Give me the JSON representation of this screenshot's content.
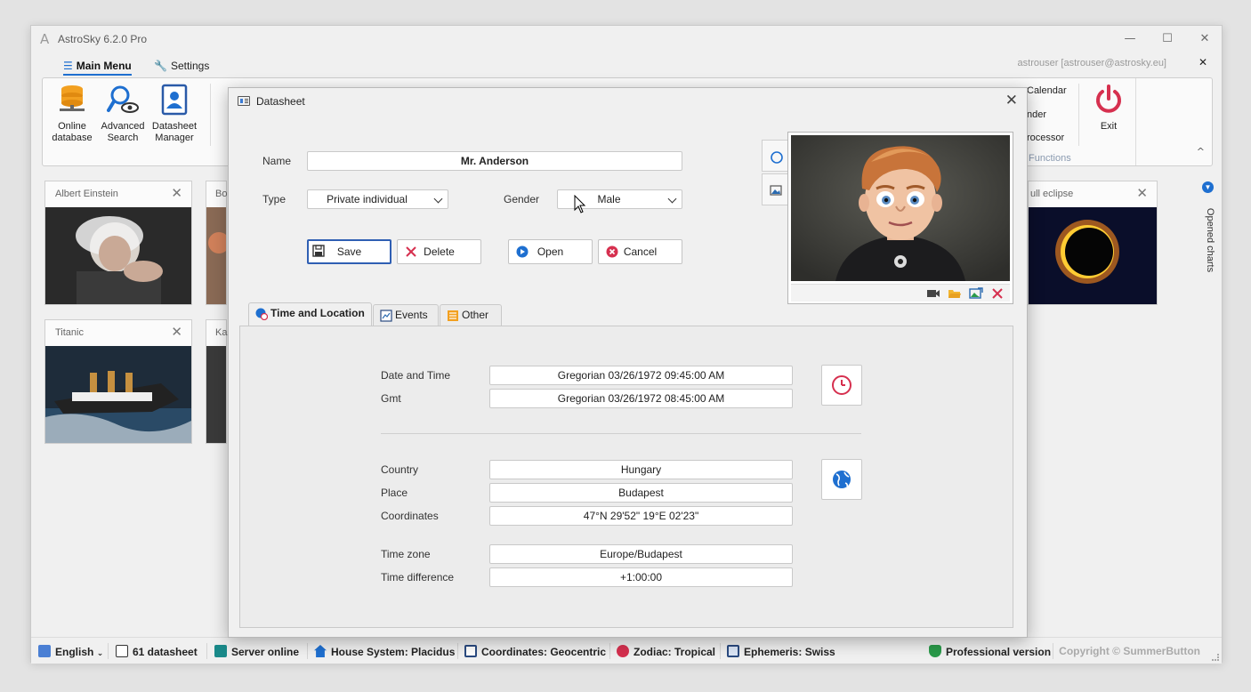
{
  "app": {
    "title": "AstroSky 6.2.0 Pro",
    "logo_letter": "A",
    "window_controls": {
      "minimize": "—",
      "maximize": "☐",
      "close": "✕"
    }
  },
  "menu": {
    "tabs": [
      {
        "label": "Main Menu",
        "icon": "hamburger-icon",
        "active": true
      },
      {
        "label": "Settings",
        "icon": "wrench-icon",
        "active": false
      }
    ],
    "user": "astrouser [astrouser@astrosky.eu]",
    "user_close": "✕"
  },
  "ribbon": {
    "buttons": [
      {
        "label_line1": "Online",
        "label_line2": "database",
        "icon": "database-icon"
      },
      {
        "label_line1": "Advanced",
        "label_line2": "Search",
        "icon": "search-eye-icon"
      },
      {
        "label_line1": "Datasheet",
        "label_line2": "Manager",
        "icon": "datasheet-icon"
      }
    ],
    "right_list": [
      "Calendar",
      "nder",
      "rocessor"
    ],
    "group_label": "Functions",
    "exit_label": "Exit",
    "collapse": "^"
  },
  "opened_charts": {
    "label": "Opened charts"
  },
  "cards": [
    {
      "title": "Albert Einstein",
      "close": "✕"
    },
    {
      "title": "Bor",
      "close": ""
    },
    {
      "title": "Titanic",
      "close": "✕"
    },
    {
      "title": "Kar",
      "close": ""
    },
    {
      "title": "ull eclipse",
      "close": "✕"
    }
  ],
  "dialog": {
    "title": "Datasheet",
    "close": "✕",
    "name_label": "Name",
    "name_value": "Mr. Anderson",
    "type_label": "Type",
    "type_value": "Private individual",
    "gender_label": "Gender",
    "gender_value": "Male",
    "buttons": {
      "save": "Save",
      "delete": "Delete",
      "open": "Open",
      "cancel": "Cancel"
    },
    "tabs": [
      {
        "label": "Time and Location",
        "active": true
      },
      {
        "label": "Events",
        "active": false
      },
      {
        "label": "Other",
        "active": false
      }
    ],
    "time": {
      "date_label": "Date and Time",
      "date_value": "Gregorian  03/26/1972 09:45:00 AM",
      "gmt_label": "Gmt",
      "gmt_value": "Gregorian  03/26/1972 08:45:00 AM"
    },
    "location": {
      "country_label": "Country",
      "country_value": "Hungary",
      "place_label": "Place",
      "place_value": "Budapest",
      "coords_label": "Coordinates",
      "coords_value": "47°N 29'52\"   19°E 02'23\"",
      "tz_label": "Time zone",
      "tz_value": "Europe/Budapest",
      "tdiff_label": "Time difference",
      "tdiff_value": "+1:00:00"
    }
  },
  "status": {
    "language": "English",
    "datasheets": "61 datasheet",
    "server": "Server online",
    "house": "House System: Placidus",
    "coords": "Coordinates: Geocentric",
    "zodiac": "Zodiac: Tropical",
    "ephemeris": "Ephemeris: Swiss",
    "version": "Professional version",
    "copyright": "Copyright © SummerButton"
  },
  "colors": {
    "accent": "#1e6fd0",
    "danger": "#d6304f",
    "border": "#c9c9c9"
  }
}
